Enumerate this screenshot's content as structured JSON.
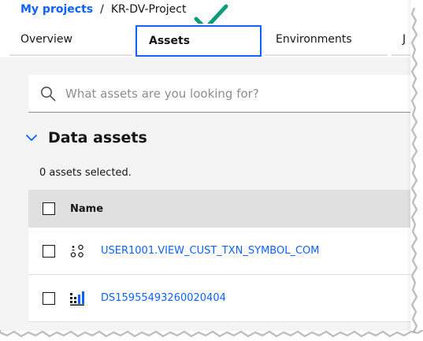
{
  "breadcrumb": {
    "parent": "My projects",
    "separator": "/",
    "current": "KR-DV-Project"
  },
  "tabs": [
    {
      "label": "Overview",
      "active": false
    },
    {
      "label": "Assets",
      "active": true
    },
    {
      "label": "Environments",
      "active": false
    },
    {
      "label": "J",
      "active": false
    }
  ],
  "search": {
    "placeholder": "What assets are you looking for?",
    "value": ""
  },
  "section": {
    "title": "Data assets",
    "expanded": true,
    "selected_text": "0 assets selected."
  },
  "table": {
    "header": {
      "name": "Name"
    },
    "rows": [
      {
        "name": "USER1001.VIEW_CUST_TXN_SYMBOL_COM",
        "icon": "data-view-icon"
      },
      {
        "name": "DS15955493260020404",
        "icon": "dataset-icon"
      }
    ]
  },
  "colors": {
    "accent": "#0f62fe",
    "checkmark": "#0e9a7b",
    "panel": "#f4f4f4",
    "header_row": "#e0e0e0"
  }
}
